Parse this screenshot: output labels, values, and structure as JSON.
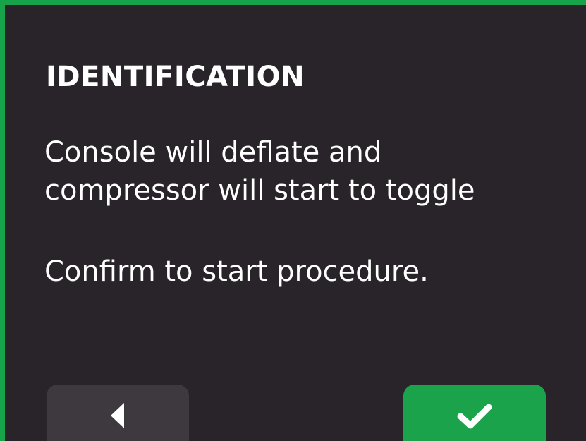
{
  "dialog": {
    "title": "IDENTIFICATION",
    "message_lines": [
      "Console will deflate and",
      "compressor will start to toggle"
    ],
    "confirm_prompt": "Confirm to start procedure."
  },
  "buttons": {
    "back": {
      "icon": "triangle-left-icon"
    },
    "confirm": {
      "icon": "checkmark-icon"
    }
  },
  "colors": {
    "background": "#282429",
    "accent_green": "#1aa34a",
    "back_button": "#3d393f",
    "text": "#ffffff"
  }
}
